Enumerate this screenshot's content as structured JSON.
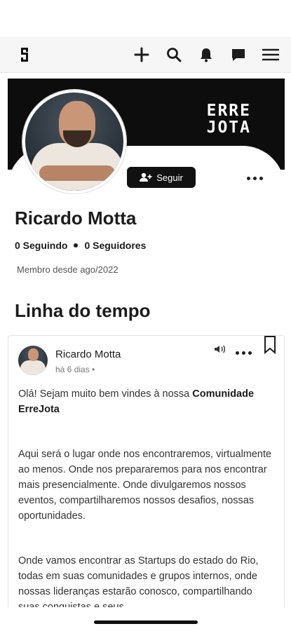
{
  "topbar": {
    "icons": [
      "logo-icon",
      "plus-icon",
      "search-icon",
      "bell-icon",
      "chat-icon",
      "menu-icon"
    ]
  },
  "cover": {
    "brand_line1": "ERRE",
    "brand_line2": "JOTA",
    "background": "#0d0d0d"
  },
  "profile": {
    "follow_label": "Seguir",
    "name": "Ricardo Motta",
    "following": "0 Seguindo",
    "followers": "0 Seguidores",
    "member_since": "Membro desde ago/2022"
  },
  "timeline": {
    "title": "Linha do tempo"
  },
  "post": {
    "author": "Ricardo Motta",
    "time": "há 6 dias •",
    "p1_text": "Olá! Sejam muito bem vindes à nossa ",
    "p1_bold": "Comunidade ErreJota",
    "p2": "Aqui será o lugar onde nos encontraremos, virtualmente ao menos. Onde nos prepararemos para nos encontrar mais presencialmente. Onde divulgaremos nossos eventos, compartilharemos nossos desafios, nossas oportunidades.",
    "p3": "Onde vamos encontrar as Startups do estado do Rio, todas em suas comunidades e grupos internos, onde nossas lideranças estarão conosco, compartilhando suas conquistas e seus"
  },
  "colors": {
    "accent": "#111111",
    "text": "#1c1c1c",
    "muted": "#777777"
  }
}
